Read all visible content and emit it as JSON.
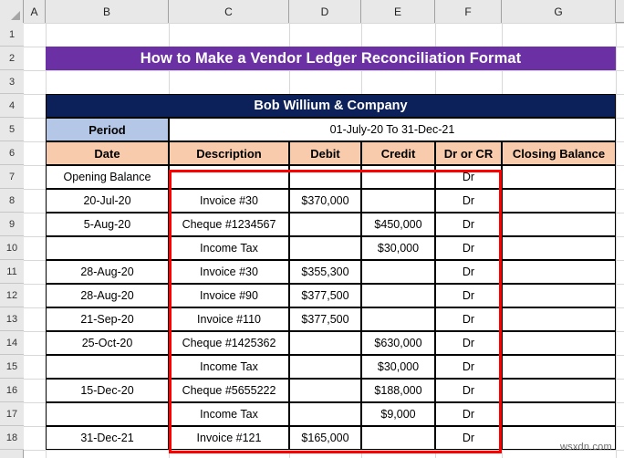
{
  "spreadsheet": {
    "column_headers": [
      "A",
      "B",
      "C",
      "D",
      "E",
      "F",
      "G"
    ],
    "row_headers": [
      "1",
      "2",
      "3",
      "4",
      "5",
      "6",
      "7",
      "8",
      "9",
      "10",
      "11",
      "12",
      "13",
      "14",
      "15",
      "16",
      "17",
      "18"
    ],
    "title_banner": "How to Make a Vendor Ledger Reconciliation Format",
    "company_name": "Bob Willium & Company",
    "period_label": "Period",
    "period_value": "01-July-20 To 31-Dec-21",
    "table_headers": [
      "Date",
      "Description",
      "Debit",
      "Credit",
      "Dr or CR",
      "Closing Balance"
    ],
    "rows": [
      {
        "date": "Opening Balance",
        "description": "",
        "debit": "",
        "credit": "",
        "dr_or_cr": "Dr",
        "closing_balance": ""
      },
      {
        "date": "20-Jul-20",
        "description": "Invoice #30",
        "debit": "$370,000",
        "credit": "",
        "dr_or_cr": "Dr",
        "closing_balance": ""
      },
      {
        "date": "5-Aug-20",
        "description": "Cheque #1234567",
        "debit": "",
        "credit": "$450,000",
        "dr_or_cr": "Dr",
        "closing_balance": ""
      },
      {
        "date": "",
        "description": "Income Tax",
        "debit": "",
        "credit": "$30,000",
        "dr_or_cr": "Dr",
        "closing_balance": ""
      },
      {
        "date": "28-Aug-20",
        "description": "Invoice #30",
        "debit": "$355,300",
        "credit": "",
        "dr_or_cr": "Dr",
        "closing_balance": ""
      },
      {
        "date": "28-Aug-20",
        "description": "Invoice #90",
        "debit": "$377,500",
        "credit": "",
        "dr_or_cr": "Dr",
        "closing_balance": ""
      },
      {
        "date": "21-Sep-20",
        "description": "Invoice #110",
        "debit": "$377,500",
        "credit": "",
        "dr_or_cr": "Dr",
        "closing_balance": ""
      },
      {
        "date": "25-Oct-20",
        "description": "Cheque #1425362",
        "debit": "",
        "credit": "$630,000",
        "dr_or_cr": "Dr",
        "closing_balance": ""
      },
      {
        "date": "",
        "description": "Income Tax",
        "debit": "",
        "credit": "$30,000",
        "dr_or_cr": "Dr",
        "closing_balance": ""
      },
      {
        "date": "15-Dec-20",
        "description": "Cheque #5655222",
        "debit": "",
        "credit": "$188,000",
        "dr_or_cr": "Dr",
        "closing_balance": ""
      },
      {
        "date": "",
        "description": "Income Tax",
        "debit": "",
        "credit": "$9,000",
        "dr_or_cr": "Dr",
        "closing_balance": ""
      },
      {
        "date": "31-Dec-21",
        "description": "Invoice #121",
        "debit": "$165,000",
        "credit": "",
        "dr_or_cr": "Dr",
        "closing_balance": ""
      }
    ],
    "watermark": "wsxdn.com",
    "colors": {
      "title_banner_bg": "#6C30A5",
      "company_bar_bg": "#0C2159",
      "period_label_bg": "#B4C7E7",
      "table_header_bg": "#F8CBAD",
      "selection_border": "#FF0000",
      "grid_header_bg": "#E8E8E8"
    }
  }
}
